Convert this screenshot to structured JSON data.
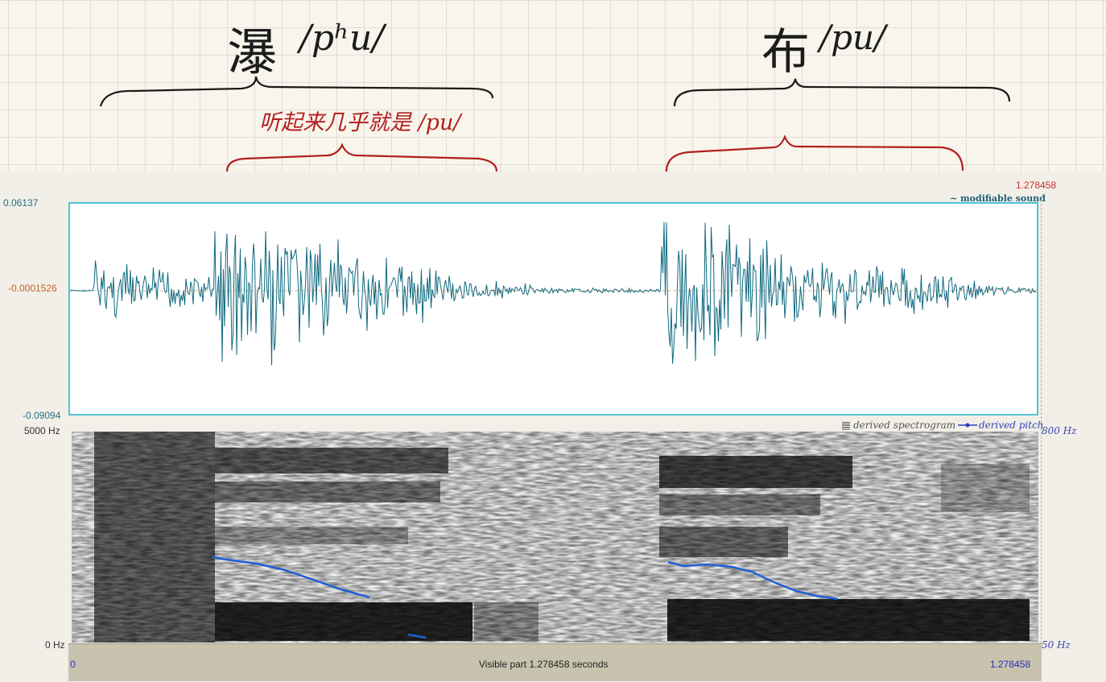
{
  "annotations": {
    "left_char": "瀑",
    "left_ipa": "/pʰu/",
    "left_note": "听起来几乎就是 /pu/",
    "right_char": "布",
    "right_ipa": "/pu/"
  },
  "praat": {
    "total_duration_label": "1.278458",
    "sound_legend": "~ modifiable sound",
    "wave_max": "0.06137",
    "wave_center": "-0.0001526",
    "wave_min": "-0.09094",
    "spec_legend_spectrogram": "derived spectrogram",
    "spec_legend_pitch": "derived pitch",
    "spec_freq_top": "5000 Hz",
    "spec_freq_bottom": "0 Hz",
    "pitch_top": "800 Hz",
    "pitch_bottom": "50 Hz",
    "time_start": "0",
    "time_end": "1.278458",
    "visible_part": "Visible part 1.278458 seconds"
  },
  "colors": {
    "waveform": "#0f6a80",
    "pitch": "#1f5fd6",
    "time_red": "#c8322e",
    "amp_label": "#2c6e86",
    "center_label": "#c0622a",
    "pitch_label": "#3a43b5"
  }
}
